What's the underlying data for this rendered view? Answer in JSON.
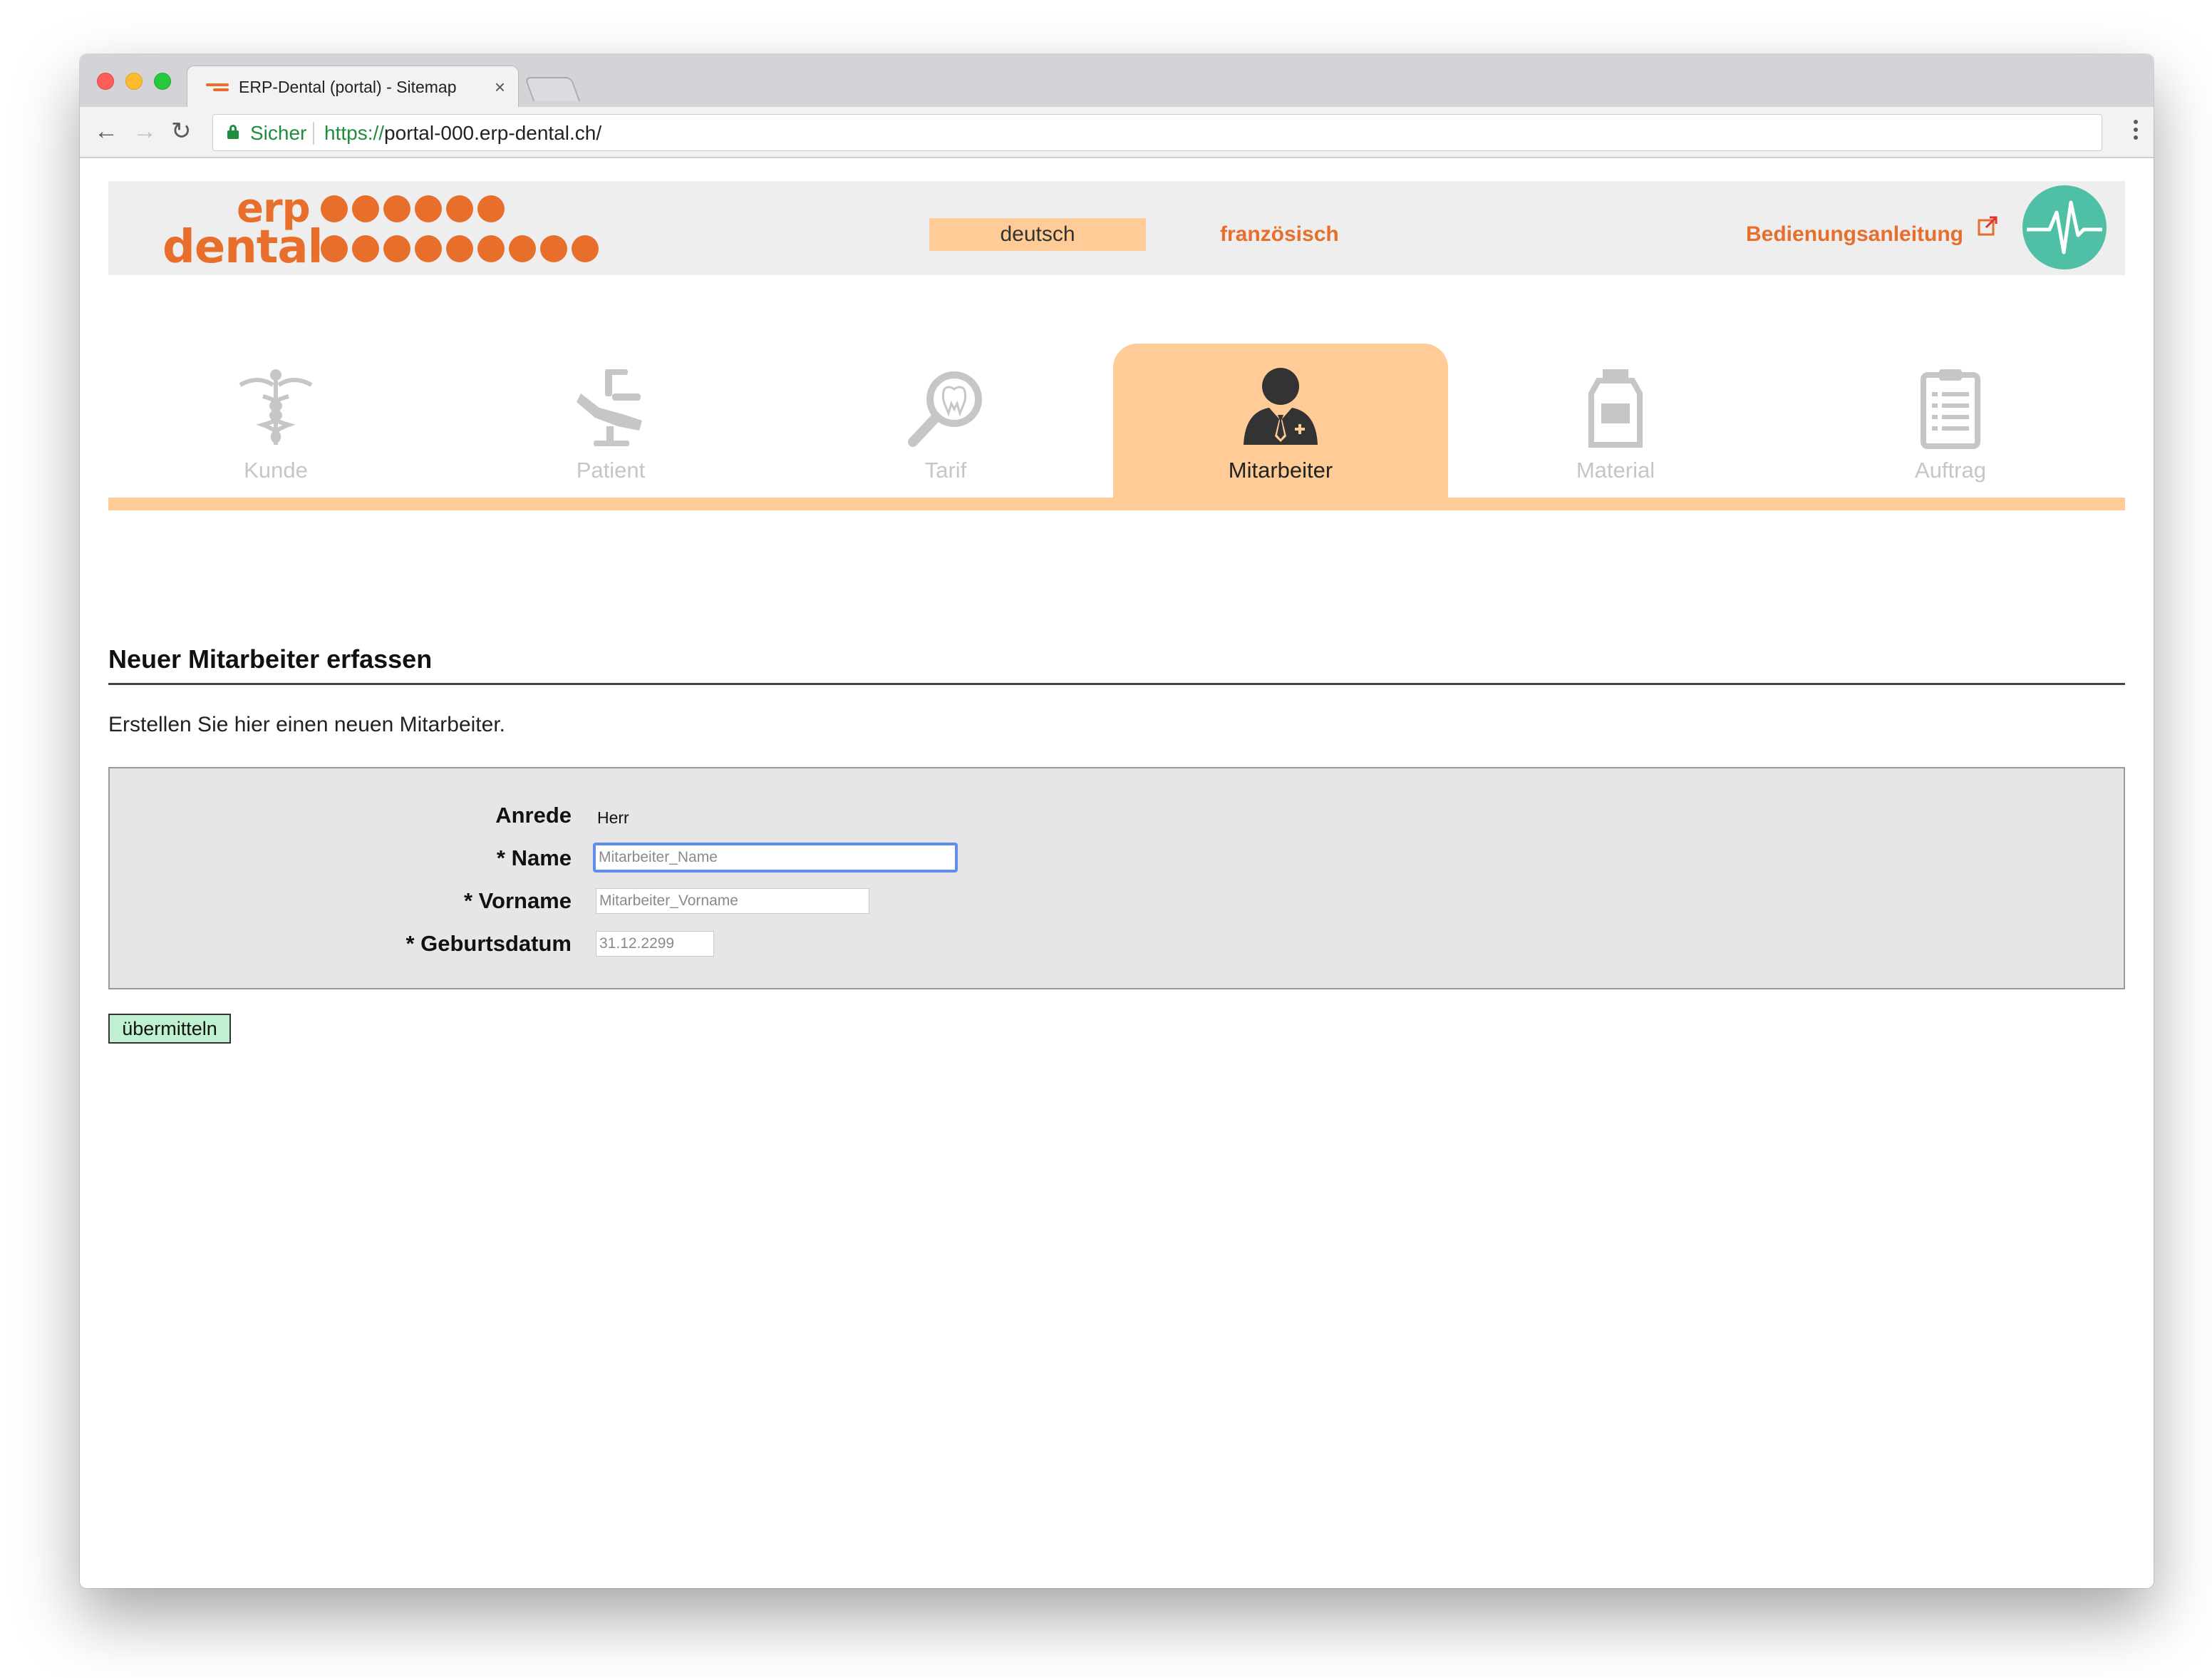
{
  "browser": {
    "tab_title": "ERP-Dental (portal) - Sitemap",
    "tab_close": "×",
    "secure_label": "Sicher",
    "url_scheme": "https://",
    "url_rest": "portal-000.erp-dental.ch/",
    "nav": {
      "back": "←",
      "forward": "→",
      "reload": "↻"
    }
  },
  "header": {
    "logo_line1": "erp",
    "logo_line2": "dental",
    "lang_active": "deutsch",
    "lang_other": "französisch",
    "manual_link": "Bedienungsanleitung",
    "brand_color": "#e86e2c",
    "accent_color": "#ffcb96",
    "pulse_color": "#4fbfa5"
  },
  "modules": [
    {
      "label": "Kunde",
      "icon": "caduceus-icon",
      "active": false
    },
    {
      "label": "Patient",
      "icon": "dental-chair-icon",
      "active": false
    },
    {
      "label": "Tarif",
      "icon": "tooth-magnifier-icon",
      "active": false
    },
    {
      "label": "Mitarbeiter",
      "icon": "staff-person-icon",
      "active": true
    },
    {
      "label": "Material",
      "icon": "jar-icon",
      "active": false
    },
    {
      "label": "Auftrag",
      "icon": "clipboard-icon",
      "active": false
    }
  ],
  "content": {
    "title": "Neuer Mitarbeiter erfassen",
    "intro": "Erstellen Sie hier einen neuen Mitarbeiter.",
    "form": {
      "anrede_label": "Anrede",
      "anrede_value": "Herr",
      "name_label": "* Name",
      "name_placeholder": "Mitarbeiter_Name",
      "vorname_label": "* Vorname",
      "vorname_placeholder": "Mitarbeiter_Vorname",
      "geburtsdatum_label": "* Geburtsdatum",
      "geburtsdatum_placeholder": "31.12.2299"
    },
    "submit_label": "übermitteln"
  }
}
